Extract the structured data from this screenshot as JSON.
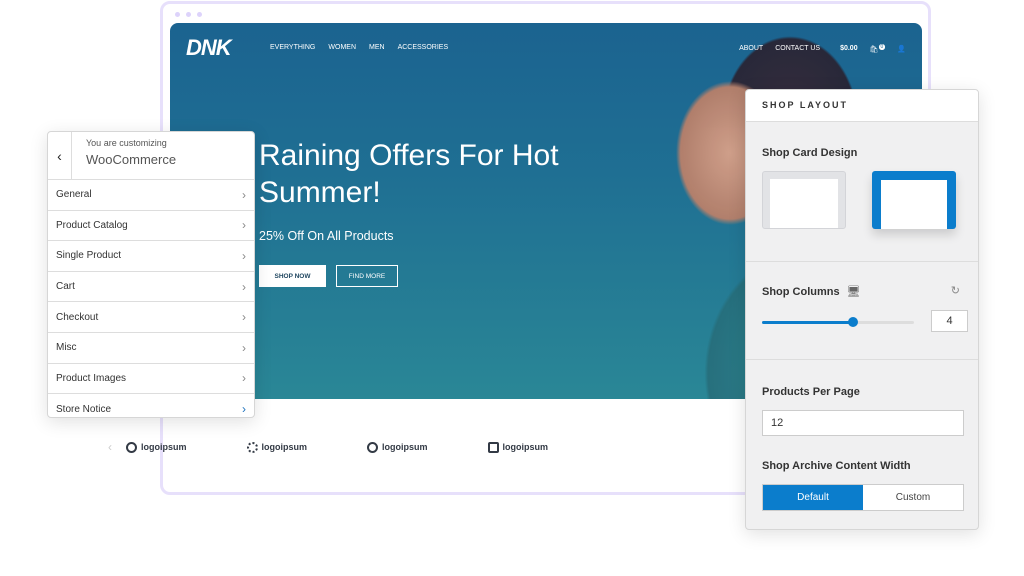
{
  "site": {
    "logo": "DNK",
    "menu": [
      "EVERYTHING",
      "WOMEN",
      "MEN",
      "ACCESSORIES"
    ],
    "about": "ABOUT",
    "contact": "CONTACT US",
    "cart_total": "$0.00",
    "cart_count": "0",
    "hero_title": "Raining Offers For Hot Summer!",
    "hero_sub": "25% Off On All Products",
    "shop_now": "SHOP NOW",
    "find_more": "FIND MORE",
    "logos": [
      "logoipsum",
      "logoipsum",
      "logoipsum",
      "logoipsum"
    ]
  },
  "customizer": {
    "back": "‹",
    "caption": "You are customizing",
    "title": "WooCommerce",
    "items": [
      "General",
      "Product Catalog",
      "Single Product",
      "Cart",
      "Checkout",
      "Misc",
      "Product Images",
      "Store Notice"
    ]
  },
  "layout": {
    "title": "SHOP LAYOUT",
    "card_design": "Shop Card Design",
    "columns_label": "Shop Columns",
    "columns_value": "4",
    "columns_slider_percent": 60,
    "per_page_label": "Products Per Page",
    "per_page_value": "12",
    "width_label": "Shop Archive Content Width",
    "width_options": [
      "Default",
      "Custom"
    ],
    "width_selected": "Default",
    "accent": "#0b7dcc"
  }
}
